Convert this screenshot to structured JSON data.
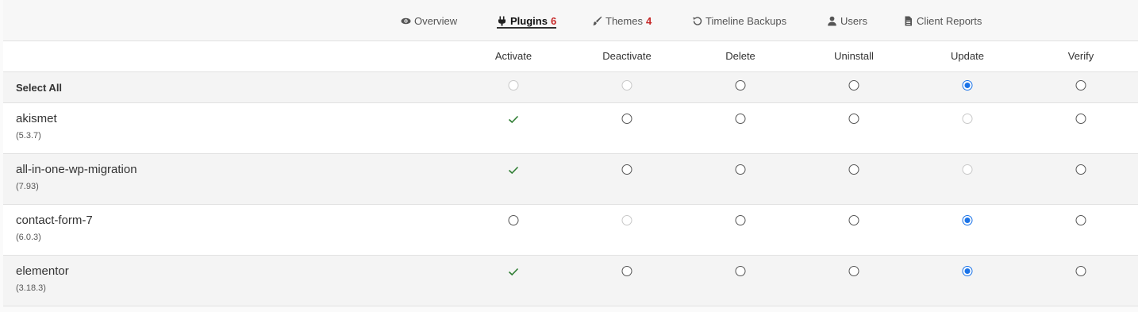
{
  "tabs": [
    {
      "label": "Overview",
      "icon": "eye-icon",
      "count": ""
    },
    {
      "label": "Plugins",
      "icon": "plug-icon",
      "count": "6",
      "active": true
    },
    {
      "label": "Themes",
      "icon": "brush-icon",
      "count": "4"
    },
    {
      "label": "Timeline Backups",
      "icon": "history-icon",
      "count": ""
    },
    {
      "label": "Users",
      "icon": "user-icon",
      "count": ""
    },
    {
      "label": "Client Reports",
      "icon": "file-icon",
      "count": ""
    }
  ],
  "columns": [
    "Activate",
    "Deactivate",
    "Delete",
    "Uninstall",
    "Update",
    "Verify"
  ],
  "select_all": {
    "label": "Select All",
    "states": [
      "disabled",
      "disabled",
      "unchecked",
      "unchecked",
      "checked",
      "unchecked"
    ]
  },
  "plugins": [
    {
      "name": "akismet",
      "version": "(5.3.7)",
      "states": [
        "check",
        "unchecked",
        "unchecked",
        "unchecked",
        "disabled",
        "unchecked"
      ]
    },
    {
      "name": "all-in-one-wp-migration",
      "version": "(7.93)",
      "states": [
        "check",
        "unchecked",
        "unchecked",
        "unchecked",
        "disabled",
        "unchecked"
      ]
    },
    {
      "name": "contact-form-7",
      "version": "(6.0.3)",
      "states": [
        "unchecked",
        "disabled",
        "unchecked",
        "unchecked",
        "checked",
        "unchecked"
      ]
    },
    {
      "name": "elementor",
      "version": "(3.18.3)",
      "states": [
        "check",
        "unchecked",
        "unchecked",
        "unchecked",
        "checked",
        "unchecked"
      ]
    }
  ],
  "colors": {
    "accent": "#1a73e8",
    "count": "#c62828",
    "check": "#2e7d32"
  }
}
